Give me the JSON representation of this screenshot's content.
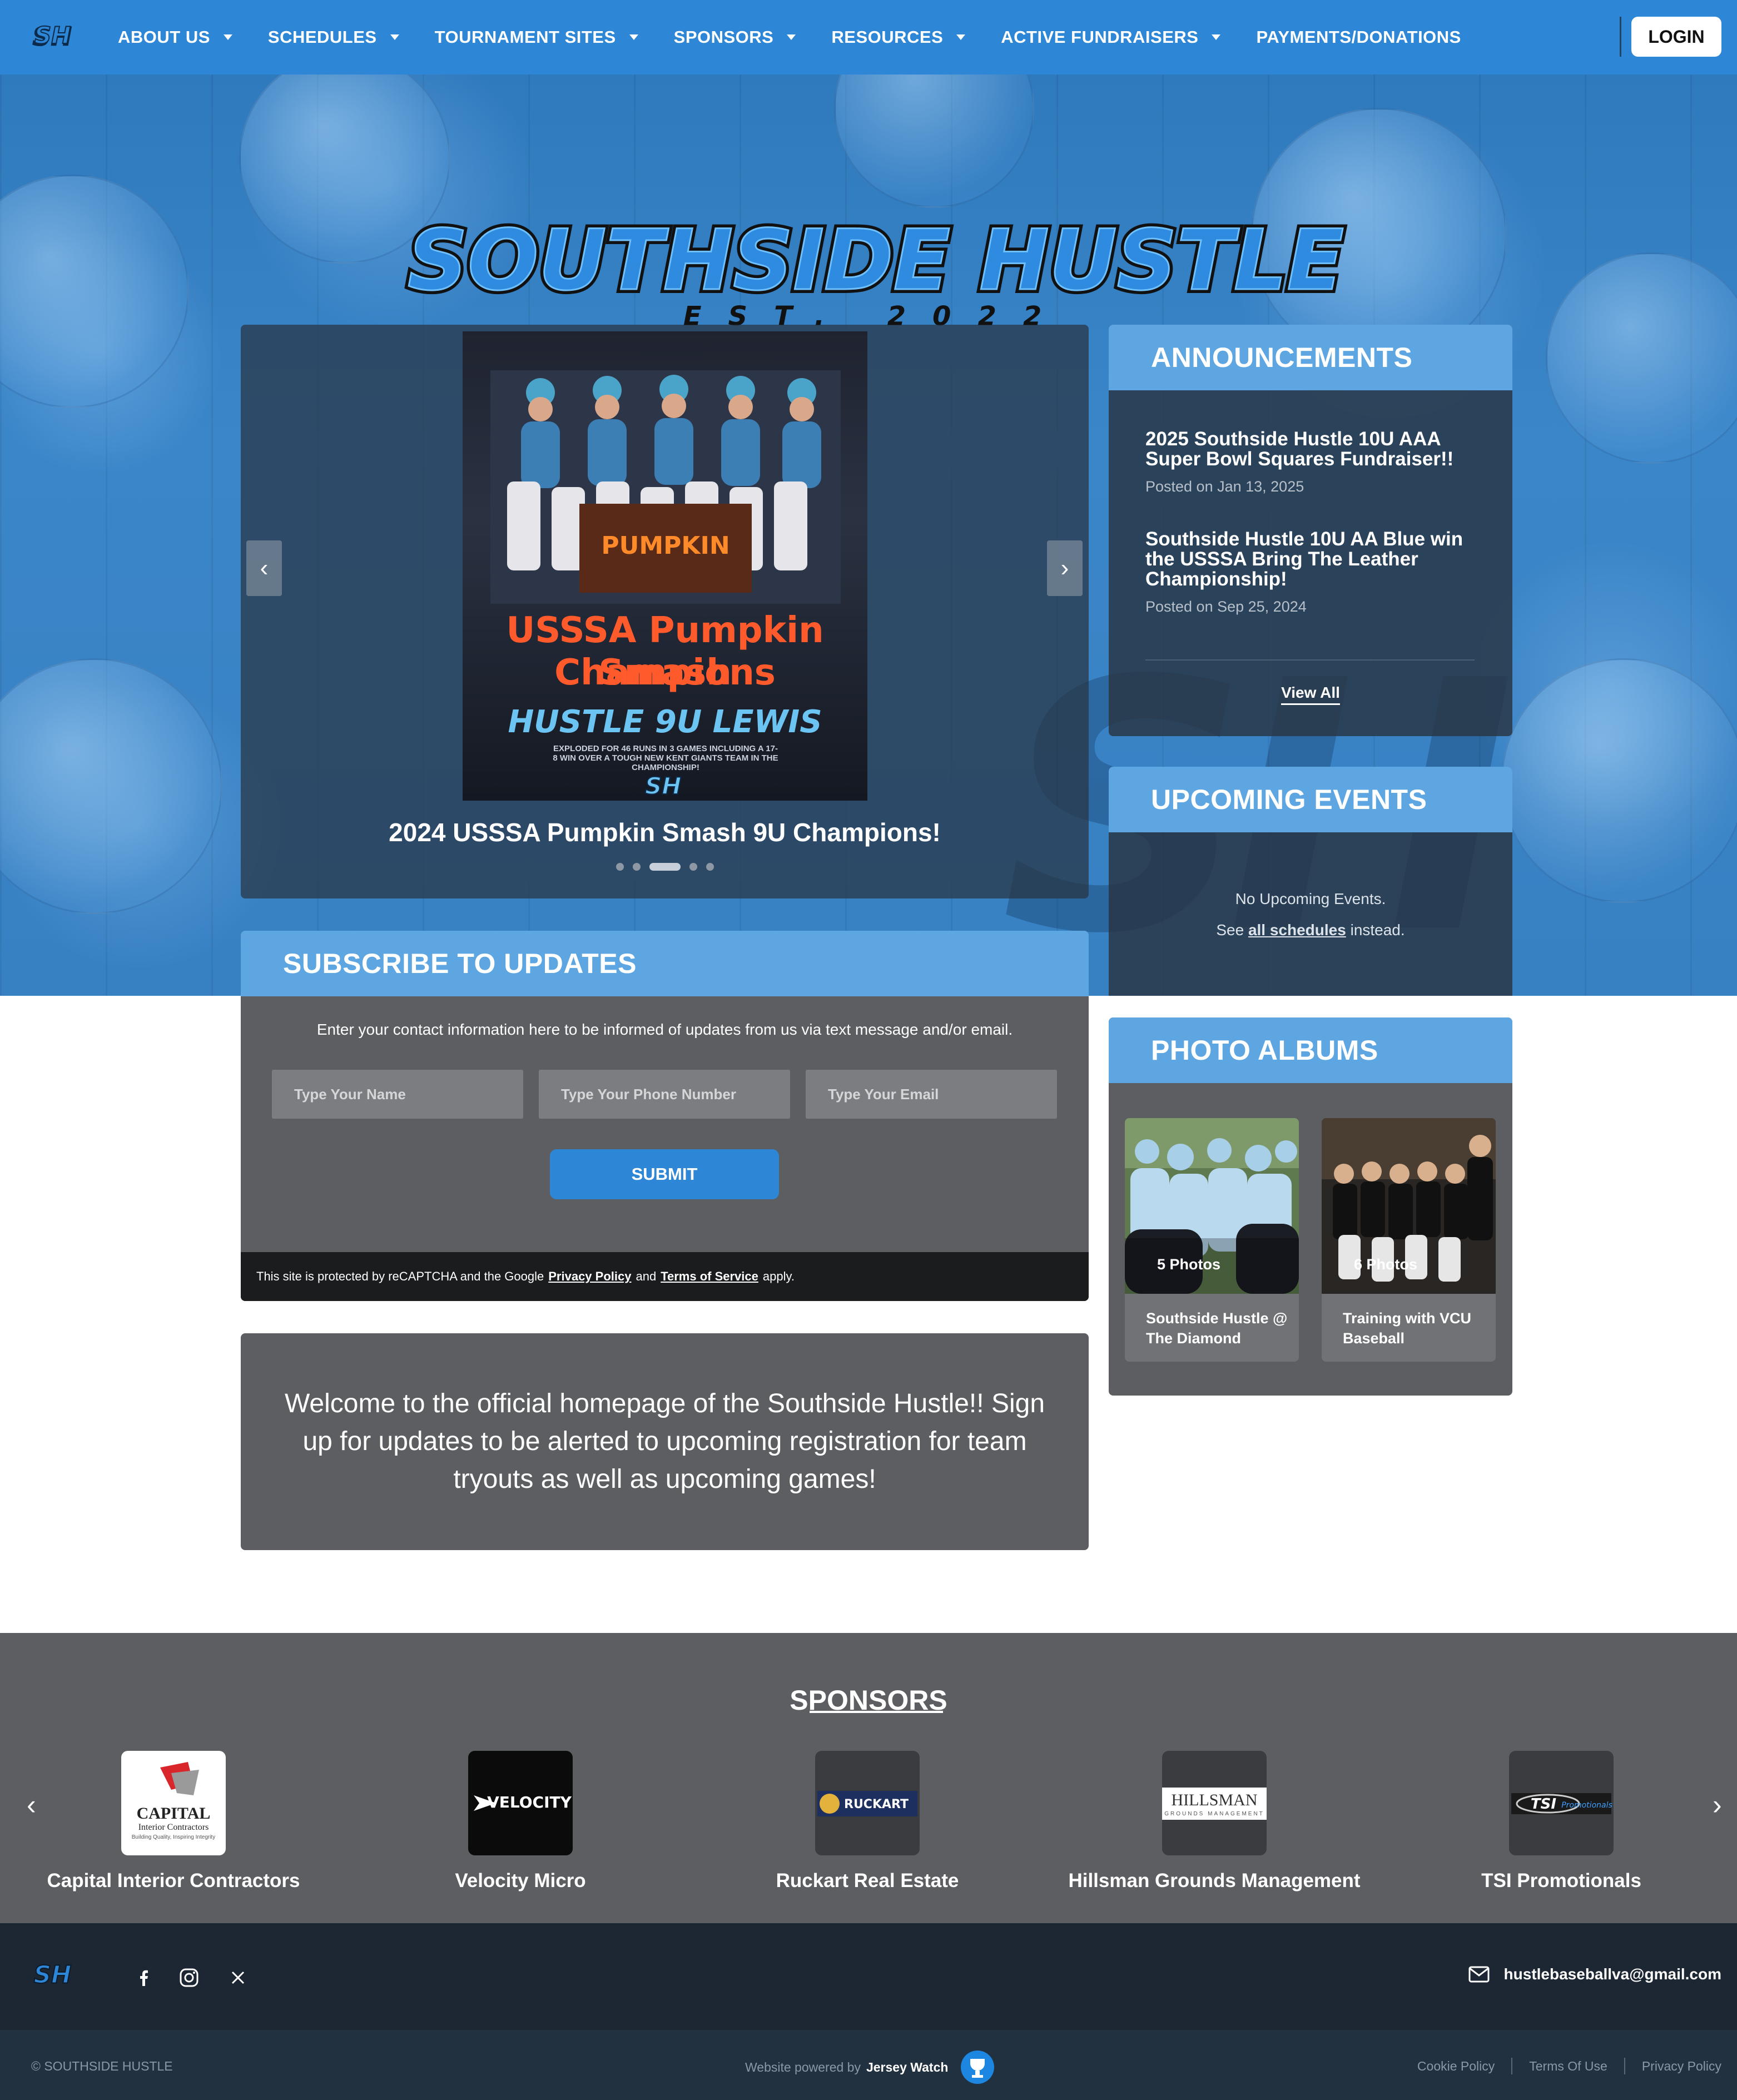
{
  "nav": {
    "logo_icon": "sh-monogram-logo",
    "items": [
      {
        "label": "ABOUT US",
        "has_dropdown": true
      },
      {
        "label": "SCHEDULES",
        "has_dropdown": true
      },
      {
        "label": "TOURNAMENT SITES",
        "has_dropdown": true
      },
      {
        "label": "SPONSORS",
        "has_dropdown": true
      },
      {
        "label": "RESOURCES",
        "has_dropdown": true
      },
      {
        "label": "ACTIVE FUNDRAISERS",
        "has_dropdown": true
      },
      {
        "label": "PAYMENTS/DONATIONS",
        "has_dropdown": false
      }
    ],
    "login_label": "LOGIN"
  },
  "hero": {
    "title": "SOUTHSIDE HUSTLE",
    "subtitle": "EST. 2022"
  },
  "carousel": {
    "slide_text": {
      "headline_1": "USSSA Pumpkin Smash",
      "headline_2": "Champions",
      "team": "HUSTLE 9U LEWIS",
      "detail": "EXPLODED FOR 46 RUNS IN 3 GAMES INCLUDING A 17-8 WIN OVER A TOUGH NEW KENT GIANTS TEAM IN THE CHAMPIONSHIP!",
      "banner": "PUMPKIN"
    },
    "caption": "2024 USSSA Pumpkin Smash 9U Champions!",
    "prev": "‹",
    "next": "›",
    "dot_count": 5,
    "active_dot": 3
  },
  "announcements": {
    "heading": "ANNOUNCEMENTS",
    "items": [
      {
        "title": "2025 Southside Hustle 10U AAA Super Bowl Squares Fundraiser!!",
        "date": "Posted on Jan 13, 2025"
      },
      {
        "title": "Southside Hustle 10U AA Blue win the USSSA Bring The Leather Championship!",
        "date": "Posted on Sep 25, 2024"
      }
    ],
    "view_all": "View All"
  },
  "events": {
    "heading": "UPCOMING EVENTS",
    "none_text": "No Upcoming Events.",
    "see_prefix": "See ",
    "see_link": "all schedules",
    "see_suffix": " instead."
  },
  "subscribe": {
    "heading": "SUBSCRIBE TO UPDATES",
    "description": "Enter your contact information here to be informed of updates from us via text message and/or email.",
    "name_placeholder": "Type Your Name",
    "phone_placeholder": "Type Your Phone Number",
    "email_placeholder": "Type Your Email",
    "submit_label": "SUBMIT",
    "recaptcha_prefix": "This site is protected by reCAPTCHA and the Google",
    "privacy_link": "Privacy Policy",
    "and": "and",
    "terms_link": "Terms of Service",
    "recaptcha_suffix": "apply."
  },
  "welcome": {
    "text": "Welcome to the official homepage of the Southside Hustle!! Sign up for updates to be alerted to upcoming registration for team tryouts as well as upcoming games!"
  },
  "albums": {
    "heading": "PHOTO ALBUMS",
    "items": [
      {
        "count": "5 Photos",
        "name": "Southside Hustle @ The Diamond"
      },
      {
        "count": "6 Photos",
        "name": "Training with VCU Baseball"
      }
    ]
  },
  "sponsors": {
    "heading": "SPONSORS",
    "items": [
      {
        "name": "Capital Interior Contractors",
        "logo_text": "CAPITAL",
        "logo_sub": "Interior Contractors",
        "tagline": "Building Quality, Inspiring Integrity"
      },
      {
        "name": "Velocity Micro",
        "logo_text": "VELOCITY"
      },
      {
        "name": "Ruckart Real Estate",
        "logo_text": "RUCKART"
      },
      {
        "name": "Hillsman Grounds Management",
        "logo_text": "HILLSMAN",
        "logo_sub": "GROUNDS MANAGEMENT"
      },
      {
        "name": "TSI Promotionals",
        "logo_text": "TSI",
        "logo_sub": "Promotionals"
      }
    ],
    "prev": "‹",
    "next": "›"
  },
  "footer": {
    "social": [
      "facebook-icon",
      "instagram-icon",
      "x-icon"
    ],
    "email": "hustlebaseballva@gmail.com",
    "copyright": "© SOUTHSIDE HUSTLE",
    "powered_prefix": "Website powered by",
    "powered_brand": "Jersey Watch",
    "legal": [
      "Cookie Policy",
      "Terms Of Use",
      "Privacy Policy"
    ]
  },
  "colors": {
    "nav_blue": "#2d86d6",
    "card_head_blue": "#5ea6e2",
    "panel_gray": "#5c5e62",
    "footer_dark": "#1c2733"
  }
}
